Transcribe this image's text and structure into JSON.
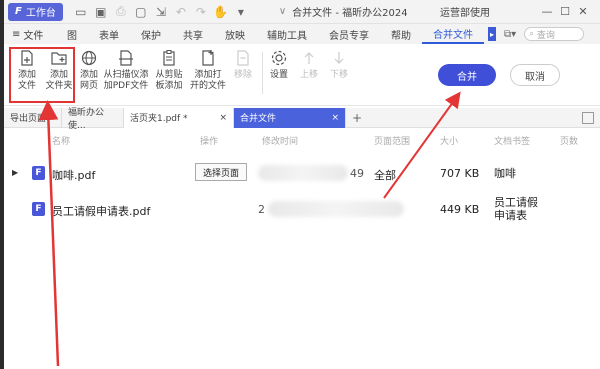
{
  "titlebar": {
    "workbench_label": "工作台",
    "workbench_logo": "F",
    "doc_title": "合并文件 - 福昕办公2024",
    "user_label": "运营部使用",
    "window_controls": [
      "—",
      "☐",
      "✕"
    ]
  },
  "menubar": {
    "file_label": "文件",
    "items": [
      {
        "label": "图"
      },
      {
        "label": "表单"
      },
      {
        "label": "保护"
      },
      {
        "label": "共享"
      },
      {
        "label": "放映"
      },
      {
        "label": "辅助工具"
      },
      {
        "label": "会员专享"
      },
      {
        "label": "帮助"
      },
      {
        "label": "合并文件",
        "active": true
      }
    ],
    "search_placeholder": "查询"
  },
  "ribbon": {
    "tools": [
      {
        "label": "添加\n文件",
        "icon": "add-file-icon"
      },
      {
        "label": "添加\n文件夹",
        "icon": "add-folder-icon"
      },
      {
        "label": "添加\n网页",
        "icon": "globe-icon"
      },
      {
        "label": "从扫描仪添\n加PDF文件",
        "icon": "scanner-icon"
      },
      {
        "label": "从剪贴\n板添加",
        "icon": "clipboard-icon"
      },
      {
        "label": "添加打\n开的文件",
        "icon": "open-file-icon"
      },
      {
        "label": "移除",
        "icon": "remove-icon",
        "disabled": true
      },
      {
        "label": "设置",
        "icon": "settings-icon"
      },
      {
        "label": "上移",
        "icon": "move-up-icon",
        "disabled": true
      },
      {
        "label": "下移",
        "icon": "move-down-icon",
        "disabled": true
      }
    ],
    "merge_label": "合并",
    "cancel_label": "取消"
  },
  "tabs": [
    {
      "label": "导出页面"
    },
    {
      "label": "福昕办公使..."
    },
    {
      "label": "活页夹1.pdf *"
    },
    {
      "label": "合并文件",
      "active": true
    }
  ],
  "columns": [
    "名称",
    "操作",
    "修改时间",
    "页面范围",
    "大小",
    "文档书签",
    "页数"
  ],
  "files": [
    {
      "name": "咖啡.pdf",
      "action": "选择页面",
      "time_tail": "49",
      "pages": "全部",
      "size": "707 KB",
      "bookmark": "咖啡"
    },
    {
      "name": "员工请假申请表.pdf",
      "action": "",
      "time_tail": "2",
      "pages": "",
      "size": "449 KB",
      "bookmark": "员工请假\n申请表"
    }
  ],
  "colors": {
    "accent": "#3f4fd8",
    "highlight": "#e43535"
  }
}
